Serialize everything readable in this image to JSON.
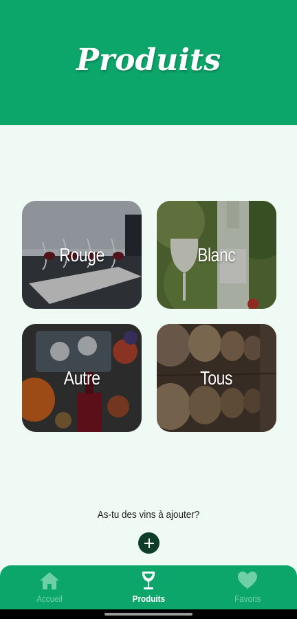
{
  "header": {
    "title": "Produits"
  },
  "categories": [
    {
      "label": "Rouge"
    },
    {
      "label": "Blanc"
    },
    {
      "label": "Autre"
    },
    {
      "label": "Tous"
    }
  ],
  "add_prompt": "As-tu des vins à ajouter?",
  "add_button_icon": "plus-icon",
  "bottom_nav": {
    "items": [
      {
        "label": "Accueil",
        "icon": "home-icon",
        "active": false
      },
      {
        "label": "Produits",
        "icon": "wine-glass-icon",
        "active": true
      },
      {
        "label": "Favoris",
        "icon": "heart-icon",
        "active": false
      }
    ]
  },
  "colors": {
    "primary": "#0da66a",
    "background": "#f0faf4",
    "button_dark": "#0e3d2a",
    "nav_inactive": "#6fd0a6",
    "nav_active": "#ffffff"
  }
}
